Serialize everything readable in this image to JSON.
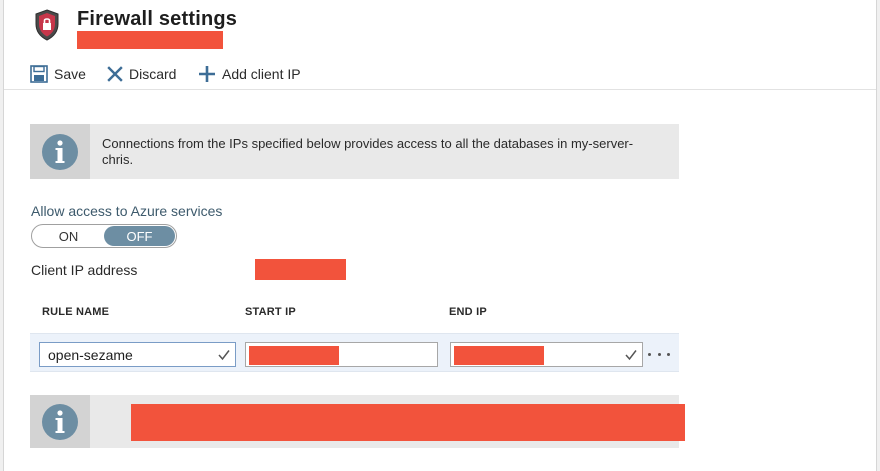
{
  "header": {
    "title": "Firewall settings",
    "icon": "shield-icon"
  },
  "toolbar": {
    "save_label": "Save",
    "discard_label": "Discard",
    "add_client_ip_label": "Add client IP"
  },
  "info_top": {
    "icon": "info-icon",
    "text": "Connections from the IPs specified below provides access to all the databases in my-server-chris."
  },
  "azure_access": {
    "label": "Allow access to Azure services",
    "options": [
      "ON",
      "OFF"
    ],
    "selected": "OFF"
  },
  "client_ip": {
    "label": "Client IP address"
  },
  "rules_table": {
    "columns": [
      "RULE NAME",
      "START IP",
      "END IP"
    ],
    "rows": [
      {
        "rule_name": "open-sezame"
      }
    ]
  },
  "info_bottom": {
    "icon": "info-icon"
  },
  "colors": {
    "redaction": "#f2533c",
    "toggle_selected": "#6d8ea3",
    "info_bg": "#e9e9e9",
    "row_highlight": "#ecf2fa"
  }
}
